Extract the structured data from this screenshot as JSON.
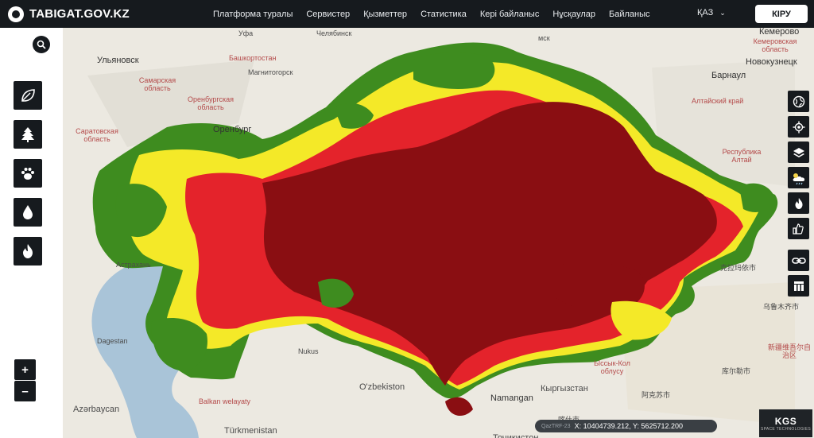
{
  "header": {
    "logo_text": "TABIGAT.GOV.KZ",
    "nav": [
      "Платформа туралы",
      "Сервистер",
      "Қызметтер",
      "Статистика",
      "Кері байланыс",
      "Нұсқаулар",
      "Байланыс"
    ],
    "language": "ҚАЗ",
    "login_label": "КІРУ"
  },
  "left_tools": [
    {
      "name": "leaf-icon"
    },
    {
      "name": "tree-icon"
    },
    {
      "name": "paw-icon"
    },
    {
      "name": "water-drop-icon"
    },
    {
      "name": "fire-icon"
    }
  ],
  "zoom": {
    "in_label": "+",
    "out_label": "–"
  },
  "right_tools": [
    {
      "name": "globe-icon"
    },
    {
      "name": "locate-icon"
    },
    {
      "name": "layers-icon"
    },
    {
      "name": "weather-icon"
    },
    {
      "name": "fire-icon"
    },
    {
      "name": "thumbs-icon"
    },
    {
      "name": "link-icon"
    },
    {
      "name": "table-icon"
    }
  ],
  "coords": {
    "projection": "QazTRF-23",
    "text": "X: 10404739.212, Y: 5625712.200"
  },
  "brand": {
    "line1": "KGS",
    "line2": "SPACE TECHNOLOGIES"
  },
  "places": [
    {
      "text": "Уфа",
      "cls": ""
    },
    {
      "text": "Челябинск",
      "cls": ""
    },
    {
      "text": "Ульяновск",
      "cls": "big"
    },
    {
      "text": "Башкортостан",
      "cls": "red"
    },
    {
      "text": "Магнитогорск",
      "cls": ""
    },
    {
      "text": "Самарская область",
      "cls": "red"
    },
    {
      "text": "Оренбургская область",
      "cls": "red"
    },
    {
      "text": "Оренбург",
      "cls": "big"
    },
    {
      "text": "Саратовская область",
      "cls": "red"
    },
    {
      "text": "Астрахань",
      "cls": ""
    },
    {
      "text": "Dagestan",
      "cls": ""
    },
    {
      "text": "Azərbaycan",
      "cls": "country"
    },
    {
      "text": "Balkan welayaty",
      "cls": "red"
    },
    {
      "text": "Türkmenistan",
      "cls": "country"
    },
    {
      "text": "Nukus",
      "cls": ""
    },
    {
      "text": "O'zbekiston",
      "cls": "country"
    },
    {
      "text": "Namangan",
      "cls": "big"
    },
    {
      "text": "Кыргызстан",
      "cls": "country"
    },
    {
      "text": "Ыссык-Кол облусу",
      "cls": "red"
    },
    {
      "text": "Тоҷикистон",
      "cls": "country"
    },
    {
      "text": "Кемерово",
      "cls": "big"
    },
    {
      "text": "Кемеровская область",
      "cls": "red"
    },
    {
      "text": "Новокузнецк",
      "cls": "big"
    },
    {
      "text": "Барнаул",
      "cls": "big"
    },
    {
      "text": "Алтайский край",
      "cls": "red"
    },
    {
      "text": "Республика Алтай",
      "cls": "red"
    },
    {
      "text": "克拉玛依市",
      "cls": ""
    },
    {
      "text": "乌鲁木齐市",
      "cls": ""
    },
    {
      "text": "新疆维吾尔自治区",
      "cls": "red"
    },
    {
      "text": "库尔勒市",
      "cls": ""
    },
    {
      "text": "阿克苏市",
      "cls": ""
    },
    {
      "text": "喀什市",
      "cls": ""
    },
    {
      "text": "мск",
      "cls": ""
    }
  ]
}
